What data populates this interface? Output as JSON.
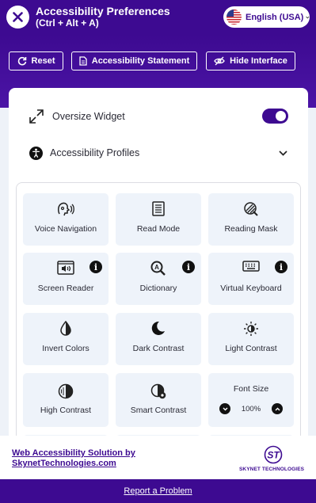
{
  "header": {
    "title": "Accessibility Preferences",
    "shortcut": "(Ctrl + Alt + A)",
    "language": "English (USA)"
  },
  "toolbar": {
    "reset_label": "Reset",
    "statement_label": "Accessibility Statement",
    "hide_label": "Hide Interface"
  },
  "panel": {
    "oversize_label": "Oversize Widget",
    "oversize_on": true,
    "profiles_label": "Accessibility Profiles"
  },
  "tiles": {
    "voice_navigation": "Voice Navigation",
    "read_mode": "Read Mode",
    "reading_mask": "Reading Mask",
    "screen_reader": "Screen Reader",
    "dictionary": "Dictionary",
    "virtual_keyboard": "Virtual Keyboard",
    "invert_colors": "Invert Colors",
    "dark_contrast": "Dark Contrast",
    "light_contrast": "Light Contrast",
    "high_contrast": "High Contrast",
    "smart_contrast": "Smart Contrast",
    "font_size": "Font Size",
    "font_size_value": "100%"
  },
  "footer": {
    "link_line1": "Web Accessibility Solution by",
    "link_line2": "SkynetTechnologies.com",
    "logo_text": "SKYNET TECHNOLOGIES",
    "logo_mark": "ST",
    "report": "Report a Problem"
  },
  "colors": {
    "brand": "#3d0a91",
    "tile_bg": "#eef3fa"
  }
}
